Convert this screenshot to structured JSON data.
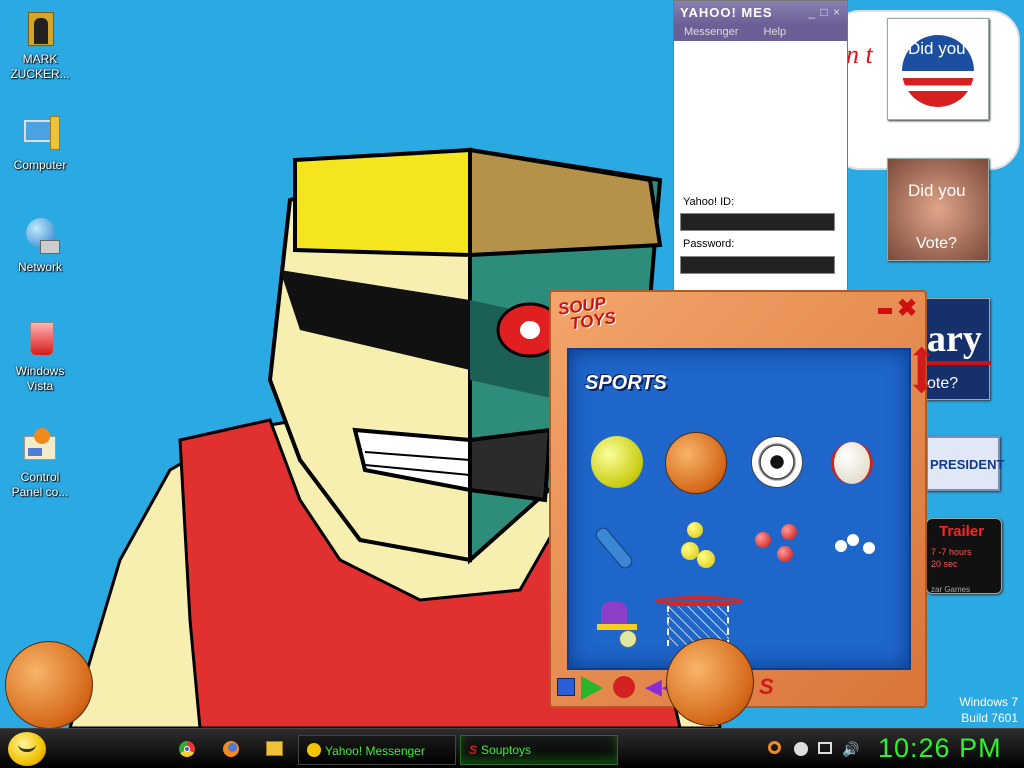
{
  "desktop": {
    "icons": [
      {
        "label": "MARK\nZUCKER..."
      },
      {
        "label": "Computer"
      },
      {
        "label": "Network"
      },
      {
        "label": "Windows\nVista"
      },
      {
        "label": "Control\nPanel co..."
      }
    ],
    "wallpaper_text": "n t",
    "side_cards": {
      "card1": "Did you",
      "card2_line1": "Did you",
      "card2_line2": "Vote?",
      "card3_big": "ary",
      "card3_small": "ote?",
      "card4": "PRESIDENT",
      "card5_title": "Trailer",
      "card5_line1": "7 -7 hours",
      "card5_line2": "20 sec",
      "card5_line3": "zar Games"
    },
    "windows_version": "Windows 7",
    "build": "Build 7601"
  },
  "yahoo": {
    "title": "YAHOO! MES",
    "controls": "_ □ ×",
    "menu": [
      "Messenger",
      "Help"
    ],
    "id_label": "Yahoo! ID:",
    "password_label": "Password:"
  },
  "souptoys": {
    "brand_line1": "SOUP",
    "brand_line2": "TOYS",
    "section_title": "SPORTS",
    "items": [
      "tennis-ball",
      "basketball",
      "soccer-ball",
      "baseball",
      "cricket-bat",
      "yellow-balls",
      "red-balls",
      "white-balls",
      "roller-skate",
      "basketball-hoop"
    ]
  },
  "taskbar": {
    "pinned": [
      "Chrome",
      "Firefox",
      "Explorer"
    ],
    "tasks": [
      {
        "label": "Yahoo! Messenger"
      },
      {
        "label": "Souptoys"
      }
    ],
    "clock": "10:26 PM"
  },
  "colors": {
    "desktop_bg": "#2aa9e3",
    "clock": "#2df22d",
    "taskbar_text": "#3cf03c"
  }
}
